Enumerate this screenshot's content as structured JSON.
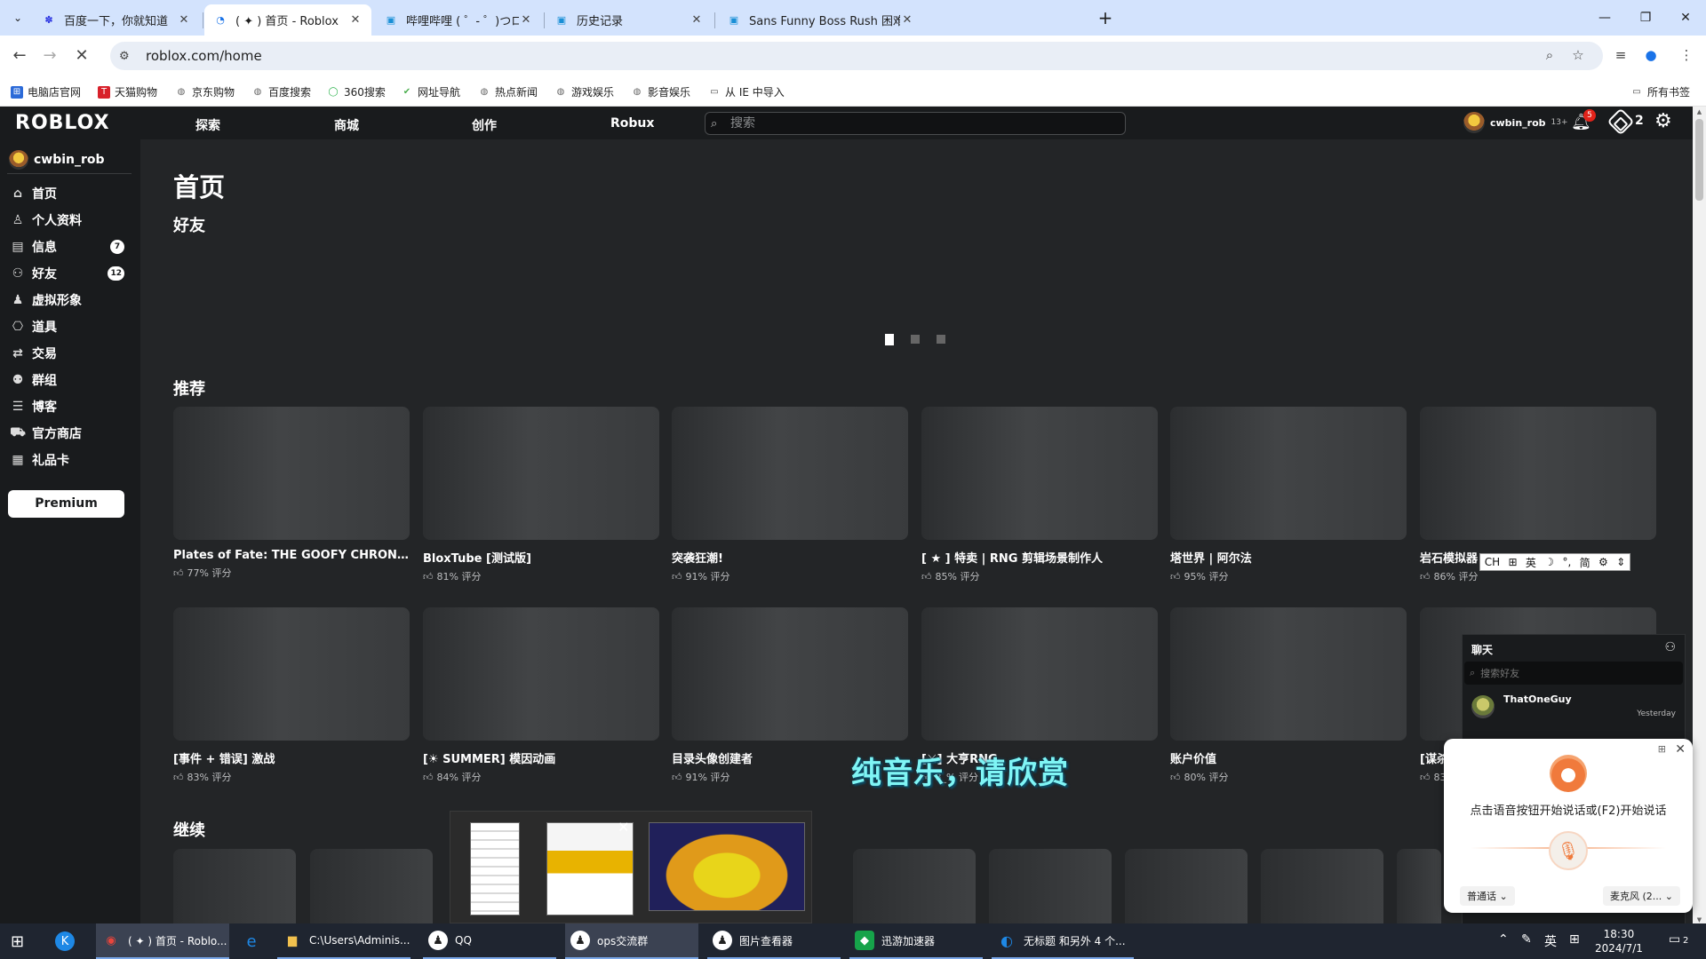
{
  "browser": {
    "tabs": [
      {
        "title": "百度一下，你就知道",
        "icon": "baidu-paw-icon"
      },
      {
        "title": "( ✦ ) 首页 - Roblox",
        "icon": "roblox-loading-icon"
      },
      {
        "title": "哔哩哔哩 ( ゜- ゜)つロ 干杯~-bi",
        "icon": "bilibili-icon"
      },
      {
        "title": "历史记录",
        "icon": "bilibili-icon"
      },
      {
        "title": "Sans Funny Boss Rush 困难模",
        "icon": "bilibili-icon"
      }
    ],
    "url": "roblox.com/home",
    "bookmarks": [
      {
        "label": "电脑店官网",
        "color": "#2b6ad8"
      },
      {
        "label": "天猫购物",
        "color": "#d8202a"
      },
      {
        "label": "京东购物",
        "color": "#777777"
      },
      {
        "label": "百度搜索",
        "color": "#777777"
      },
      {
        "label": "360搜索",
        "color": "#2bb24c"
      },
      {
        "label": "网址导航",
        "color": "#4caf50"
      },
      {
        "label": "热点新闻",
        "color": "#777777"
      },
      {
        "label": "游戏娱乐",
        "color": "#777777"
      },
      {
        "label": "影音娱乐",
        "color": "#777777"
      },
      {
        "label": "从 IE 中导入",
        "color": "#777777"
      }
    ],
    "all_bookmarks": "所有书签"
  },
  "roblox": {
    "logo": "ROBLOX",
    "nav": [
      "探索",
      "商城",
      "创作",
      "Robux"
    ],
    "search_placeholder": "搜索",
    "username": "cwbin_rob",
    "age_label": "13+",
    "notifications": "5",
    "robux": "2",
    "sidebar": {
      "username": "cwbin_rob",
      "items": [
        {
          "label": "首页",
          "icon": "home-icon"
        },
        {
          "label": "个人资料",
          "icon": "profile-icon"
        },
        {
          "label": "信息",
          "icon": "messages-icon",
          "badge": "7"
        },
        {
          "label": "好友",
          "icon": "friends-icon",
          "badge": "12"
        },
        {
          "label": "虚拟形象",
          "icon": "avatar-icon"
        },
        {
          "label": "道具",
          "icon": "inventory-icon"
        },
        {
          "label": "交易",
          "icon": "trade-icon"
        },
        {
          "label": "群组",
          "icon": "groups-icon"
        },
        {
          "label": "博客",
          "icon": "blog-icon"
        },
        {
          "label": "官方商店",
          "icon": "shop-cart-icon"
        },
        {
          "label": "礼品卡",
          "icon": "gift-card-icon"
        }
      ],
      "premium": "Premium"
    },
    "page_title": "首页",
    "friends_title": "好友",
    "recommended_title": "推荐",
    "continue_title": "继续",
    "games_row1": [
      {
        "name": "Plates of Fate: THE GOOFY CHRONIC...",
        "rating": "77% 评分"
      },
      {
        "name": "BloxTube [测试版]",
        "rating": "81% 评分"
      },
      {
        "name": "突袭狂潮!",
        "rating": "91% 评分"
      },
      {
        "name": "[ ★ ] 特卖 | RNG 剪辑场景制作人",
        "rating": "85% 评分"
      },
      {
        "name": "塔世界 | 阿尔法",
        "rating": "95% 评分"
      },
      {
        "name": "岩石模拟器",
        "rating": "86% 评分"
      }
    ],
    "games_row2": [
      {
        "name": "[事件 + 错误] 激战",
        "rating": "83% 评分"
      },
      {
        "name": "[☀ SUMMER] 模因动画",
        "rating": "84% 评分"
      },
      {
        "name": "目录头像创建者",
        "rating": "91% 评分"
      },
      {
        "name": "[⚔] 大亨RNG",
        "rating": "8_% 评分"
      },
      {
        "name": "账户价值",
        "rating": "80% 评分"
      },
      {
        "name": "[谋杀",
        "rating": "83% 评分"
      }
    ],
    "chat": {
      "title": "聊天",
      "search_placeholder": "搜索好友",
      "contacts": [
        {
          "name": "ThatOneGuy",
          "time": "Yesterday"
        }
      ]
    }
  },
  "ime_bar": [
    "CH",
    "⊞",
    "英",
    "☽",
    "°,",
    "简",
    "⚙",
    "⇕"
  ],
  "voice_popup": {
    "instruction": "点击语音按钮开始说话或(F2)开始说话",
    "language": "普通话",
    "microphone": "麦克风 (2..."
  },
  "caption": "纯音乐，请欣赏",
  "taskbar": {
    "items": [
      {
        "label": "( ✦ ) 首页 - Roblo...",
        "icon": "chrome-icon",
        "color": "#e8453c"
      },
      {
        "label": "",
        "icon": "ie-icon",
        "color": "#1e88e5"
      },
      {
        "label": "C:\\Users\\Adminis...",
        "icon": "folder-icon",
        "color": "#f2c14e"
      },
      {
        "label": "QQ",
        "icon": "qq-penguin-icon",
        "color": "#222222"
      },
      {
        "label": "ops交流群",
        "icon": "qq-penguin-icon",
        "color": "#222222"
      },
      {
        "label": "图片查看器",
        "icon": "qq-penguin-icon",
        "color": "#222222"
      },
      {
        "label": "迅游加速器",
        "icon": "xunyou-icon",
        "color": "#16a34a"
      },
      {
        "label": "无标题 和另外 4 个...",
        "icon": "edge-icon",
        "color": "#1e88e5"
      }
    ],
    "time": "18:30",
    "date": "2024/7/1",
    "ime": "英",
    "notifications": "2"
  }
}
